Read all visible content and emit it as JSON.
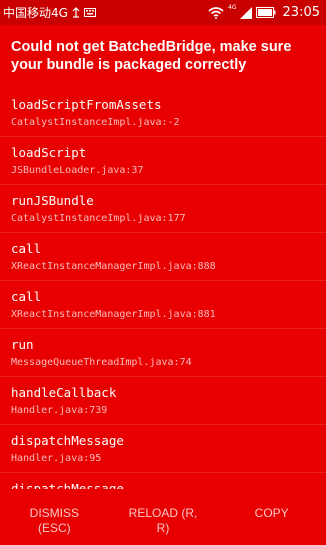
{
  "status_bar": {
    "carrier": "中国移动4G",
    "network_type": "4G",
    "time": "23:05"
  },
  "error": {
    "title": "Could not get BatchedBridge, make sure your bundle is packaged correctly"
  },
  "stack_frames": [
    {
      "method": "loadScriptFromAssets",
      "file": "CatalystInstanceImpl.java:-2"
    },
    {
      "method": "loadScript",
      "file": "JSBundleLoader.java:37"
    },
    {
      "method": "runJSBundle",
      "file": "CatalystInstanceImpl.java:177"
    },
    {
      "method": "call",
      "file": "XReactInstanceManagerImpl.java:888"
    },
    {
      "method": "call",
      "file": "XReactInstanceManagerImpl.java:881"
    },
    {
      "method": "run",
      "file": "MessageQueueThreadImpl.java:74"
    },
    {
      "method": "handleCallback",
      "file": "Handler.java:739"
    },
    {
      "method": "dispatchMessage",
      "file": "Handler.java:95"
    },
    {
      "method": "dispatchMessage",
      "file": ""
    }
  ],
  "buttons": {
    "dismiss": "DISMISS (ESC)",
    "reload": "RELOAD (R, R)",
    "copy": "COPY"
  },
  "colors": {
    "background": "#e80000",
    "status_bar": "#c90000",
    "text": "#ffffff"
  }
}
